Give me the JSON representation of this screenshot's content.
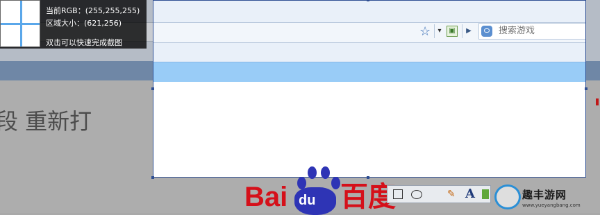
{
  "capture_info": {
    "rgb_line": "当前RGB：(255,255,255)",
    "size_line": "区域大小：(621,256)",
    "hint_line": "双击可以快速完成截图"
  },
  "browser": {
    "search_placeholder": "搜索游戏"
  },
  "background_text": "段 重新打",
  "logo": {
    "left_text": "Bai",
    "paw_text": "du",
    "right_text": "百度"
  },
  "toolbar": {
    "text_tool": "A"
  },
  "watermark": {
    "title": "趣丰游网",
    "url": "www.yueyangbang.com"
  },
  "colors": {
    "selection_border": "#2f4f93",
    "band_blue": "#99ccf7",
    "baidu_red": "#d5101a",
    "baidu_blue": "#2e34b5"
  }
}
